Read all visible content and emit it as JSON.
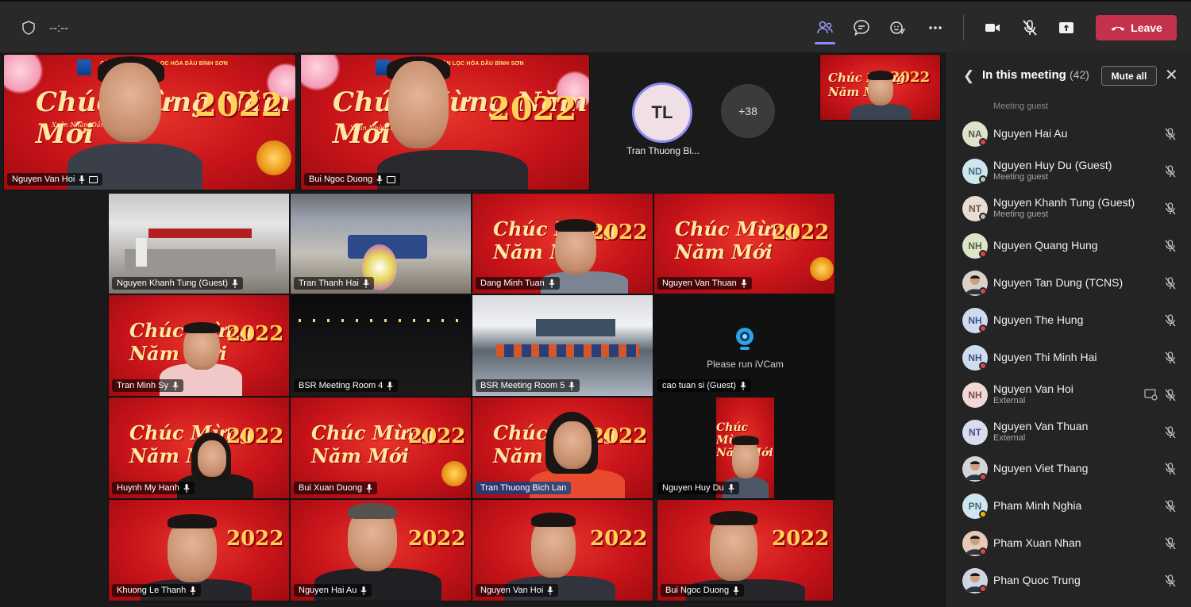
{
  "toolbar": {
    "timer": "--:--",
    "icons": [
      "shield-icon",
      "people-icon",
      "chat-icon",
      "reactions-icon",
      "more-icon",
      "camera-icon",
      "mic-off-icon",
      "share-screen-icon"
    ],
    "leave_label": "Leave",
    "leave_color": "#c4314b",
    "accent_color": "#8b8cf5"
  },
  "stage": {
    "top_row": {
      "tile1_name": "Nguyen Van Hoi",
      "tile2_name": "Bui Ngoc Duong",
      "avatar_initials": "TL",
      "avatar_name": "Tran Thuong Bi...",
      "overflow_count": "+38"
    },
    "grid": [
      {
        "name": "Nguyen Khanh Tung (Guest)"
      },
      {
        "name": "Tran Thanh Hai"
      },
      {
        "name": "Dang Minh Tuan"
      },
      {
        "name": "Nguyen Van Thuan"
      },
      {
        "name": "Tran Minh Sy"
      },
      {
        "name": "BSR Meeting Room 4"
      },
      {
        "name": "BSR Meeting Room 5"
      },
      {
        "name": "cao tuan si (Guest)"
      },
      {
        "name": "Huynh My Hanh"
      },
      {
        "name": "Bui Xuan Duong"
      },
      {
        "name": "Tran Thuong Bich Lan"
      },
      {
        "name": "Nguyen Huy Du"
      },
      {
        "name": "Khuong Le Thanh"
      },
      {
        "name": "Nguyen Hai Au"
      },
      {
        "name": "Nguyen Van Hoi"
      },
      {
        "name": "Bui Ngoc Duong"
      }
    ],
    "ivcam_message": "Please run iVCam",
    "banner": {
      "company": "CÔNG TY CỔ PHẦN LỌC HÓA DẦU BÌNH SƠN",
      "greeting": "Chúc Mừng Năm Mới",
      "year": "2022",
      "subtitle": "Xuân Nhâm Dần"
    }
  },
  "panel": {
    "title": "In this meeting",
    "count": "(42)",
    "mute_all_label": "Mute all",
    "partial_role": "Meeting guest",
    "participants": [
      {
        "initials": "NA",
        "name": "Nguyen Hai Au",
        "role": "",
        "avatar_bg": "#dfe3c9",
        "avatar_fg": "#555",
        "presence": "#d74654"
      },
      {
        "initials": "ND",
        "name": "Nguyen Huy Du (Guest)",
        "role": "Meeting guest",
        "avatar_bg": "#cfe6ef",
        "avatar_fg": "#4a6a7a",
        "presence": "#bdbdbd"
      },
      {
        "initials": "NT",
        "name": "Nguyen Khanh Tung (Guest)",
        "role": "Meeting guest",
        "avatar_bg": "#e8dcd3",
        "avatar_fg": "#6a5548",
        "presence": "#bdbdbd"
      },
      {
        "initials": "NH",
        "name": "Nguyen Quang Hung",
        "role": "",
        "avatar_bg": "#dde5c8",
        "avatar_fg": "#556040",
        "presence": "#d74654"
      },
      {
        "initials": "",
        "name": "Nguyen Tan Dung (TCNS)",
        "role": "",
        "avatar_bg": "#d9d2cb",
        "avatar_fg": "#333",
        "presence": "#d74654",
        "photo": true
      },
      {
        "initials": "NH",
        "name": "Nguyen The Hung",
        "role": "",
        "avatar_bg": "#cfdcf0",
        "avatar_fg": "#3c5680",
        "presence": "#d74654"
      },
      {
        "initials": "NH",
        "name": "Nguyen Thi Minh Hai",
        "role": "",
        "avatar_bg": "#cfdcf0",
        "avatar_fg": "#3c5680",
        "presence": "#d74654"
      },
      {
        "initials": "NH",
        "name": "Nguyen Van Hoi",
        "role": "External",
        "avatar_bg": "#f1d8d8",
        "avatar_fg": "#8a4444",
        "presence": "",
        "share": true
      },
      {
        "initials": "NT",
        "name": "Nguyen Van Thuan",
        "role": "External",
        "avatar_bg": "#d9dcef",
        "avatar_fg": "#4a4f80",
        "presence": ""
      },
      {
        "initials": "",
        "name": "Nguyen Viet Thang",
        "role": "",
        "avatar_bg": "#d2d6db",
        "avatar_fg": "#333",
        "presence": "#d74654",
        "photo": true
      },
      {
        "initials": "PN",
        "name": "Pham Minh Nghia",
        "role": "",
        "avatar_bg": "#cfe6ef",
        "avatar_fg": "#4a6a7a",
        "presence": "#f1b500"
      },
      {
        "initials": "",
        "name": "Pham Xuan Nhan",
        "role": "",
        "avatar_bg": "#e7c9b6",
        "avatar_fg": "#333",
        "presence": "#d74654",
        "photo": true
      },
      {
        "initials": "",
        "name": "Phan Quoc Trung",
        "role": "",
        "avatar_bg": "#cfd6e3",
        "avatar_fg": "#333",
        "presence": "#d74654",
        "photo": true
      }
    ]
  }
}
